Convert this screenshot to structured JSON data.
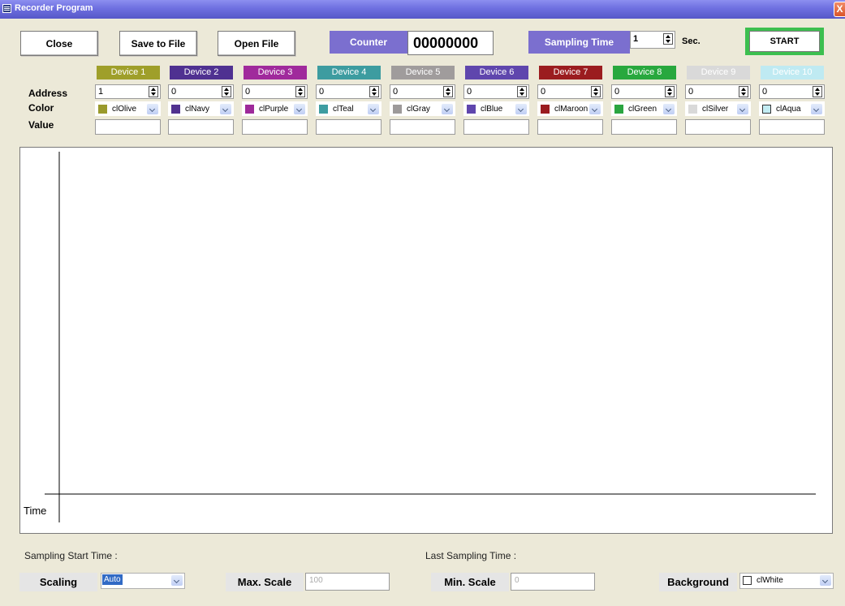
{
  "window": {
    "title": "Recorder Program",
    "close_glyph": "X"
  },
  "toolbar": {
    "close_label": "Close",
    "save_label": "Save to File",
    "open_label": "Open File",
    "counter_label": "Counter",
    "counter_value": "00000000",
    "sampling_label": "Sampling Time",
    "sampling_value": "1",
    "sampling_unit": "Sec.",
    "start_label": "START"
  },
  "rows": {
    "address": "Address",
    "color": "Color",
    "value": "Value"
  },
  "devices": [
    {
      "name": "Device 1",
      "address": "1",
      "color_name": "clOlive",
      "header_color": "#9f9f2a",
      "swatch": "#9a9a2c"
    },
    {
      "name": "Device 2",
      "address": "0",
      "color_name": "clNavy",
      "header_color": "#4f3191",
      "swatch": "#51328f"
    },
    {
      "name": "Device 3",
      "address": "0",
      "color_name": "clPurple",
      "header_color": "#a02a9c",
      "swatch": "#9e2a9a"
    },
    {
      "name": "Device 4",
      "address": "0",
      "color_name": "clTeal",
      "header_color": "#3d9ca0",
      "swatch": "#3e9da1"
    },
    {
      "name": "Device 5",
      "address": "0",
      "color_name": "clGray",
      "header_color": "#a09c9c",
      "swatch": "#9d9a9a"
    },
    {
      "name": "Device 6",
      "address": "0",
      "color_name": "clBlue",
      "header_color": "#5f46ad",
      "swatch": "#5f46ad"
    },
    {
      "name": "Device 7",
      "address": "0",
      "color_name": "clMaroon",
      "header_color": "#9b1c1f",
      "swatch": "#9a1c1f"
    },
    {
      "name": "Device 8",
      "address": "0",
      "color_name": "clGreen",
      "header_color": "#28a83e",
      "swatch": "#2aa540"
    },
    {
      "name": "Device 9",
      "address": "0",
      "color_name": "clSilver",
      "header_color": "#d9d9d9",
      "swatch": "#d9d9d9"
    },
    {
      "name": "Device 10",
      "address": "0",
      "color_name": "clAqua",
      "header_color": "#bfeaf2",
      "swatch": "#c3ecf3"
    }
  ],
  "chart": {
    "x_label": "Time"
  },
  "footer": {
    "start_time_label": "Sampling Start Time :",
    "last_time_label": "Last Sampling Time :",
    "scaling_label": "Scaling",
    "scaling_value": "Auto",
    "max_scale_label": "Max. Scale",
    "max_scale_value": "100",
    "min_scale_label": "Min. Scale",
    "min_scale_value": "0",
    "background_label": "Background",
    "background_value": "clWhite"
  },
  "colors": {
    "accent_purple": "#7b6fcf",
    "start_border": "#3cbf4f",
    "background": "#ece9d8"
  }
}
